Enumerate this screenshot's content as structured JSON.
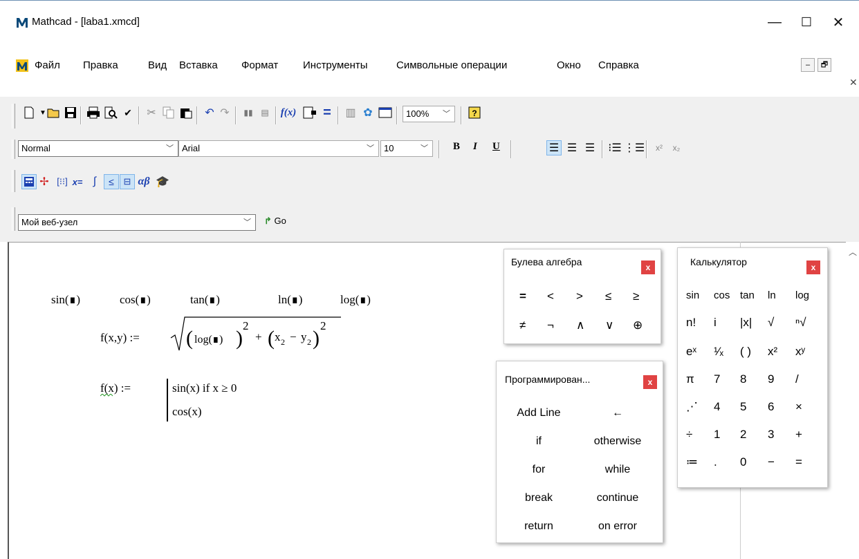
{
  "window": {
    "title": "Mathcad - [laba1.xmcd]",
    "minimize": "—",
    "maximize": "☐",
    "close": "✕"
  },
  "menubar": {
    "items": [
      "Файл",
      "Правка",
      "Вид",
      "Вставка",
      "Формат",
      "Инструменты",
      "Символьные операции",
      "Окно",
      "Справка"
    ],
    "mdi_minimize": "–",
    "mdi_restore": "🗗",
    "mdi_close": "✕"
  },
  "standard_toolbar": {
    "zoom": "100%"
  },
  "formatting_toolbar": {
    "style": "Normal",
    "font": "Arial",
    "size": "10",
    "bold": "B",
    "italic": "I",
    "underline": "U"
  },
  "web_toolbar": {
    "address": "Мой веб-узел",
    "go": "Go"
  },
  "worksheet": {
    "functions": [
      "sin(∎)",
      "cos(∎)",
      "tan(∎)",
      "ln(∎)",
      "log(∎)"
    ],
    "f1_lhs": "f(x,y) :=",
    "f1_log": "log(∎)",
    "f2_lhs": "f(x) :=",
    "f2_line1": "sin(x)  if  x ≥ 0",
    "f2_line2": "cos(x)"
  },
  "palettes": {
    "boolean": {
      "title": "Булева алгебра",
      "close": "x",
      "cells": [
        "=",
        "<",
        ">",
        "≤",
        "≥",
        "≠",
        "¬",
        "∧",
        "∨",
        "⊕"
      ]
    },
    "calculator": {
      "title": "Калькулятор",
      "close": "x",
      "rows": [
        [
          "sin",
          "cos",
          "tan",
          "ln",
          "log"
        ],
        [
          "n!",
          "i",
          "|x|",
          "√",
          "ⁿ√"
        ],
        [
          "eˣ",
          "¹⁄ₓ",
          "( )",
          "x²",
          "xʸ"
        ],
        [
          "π",
          "7",
          "8",
          "9",
          "/"
        ],
        [
          "⋰",
          "4",
          "5",
          "6",
          "×"
        ],
        [
          "÷",
          "1",
          "2",
          "3",
          "+"
        ],
        [
          "≔",
          ".",
          "0",
          "−",
          "="
        ]
      ]
    },
    "programming": {
      "title": "Программирован...",
      "close": "x",
      "rows": [
        [
          "Add Line",
          "←"
        ],
        [
          "if",
          "otherwise"
        ],
        [
          "for",
          "while"
        ],
        [
          "break",
          "continue"
        ],
        [
          "return",
          "on error"
        ]
      ]
    }
  }
}
